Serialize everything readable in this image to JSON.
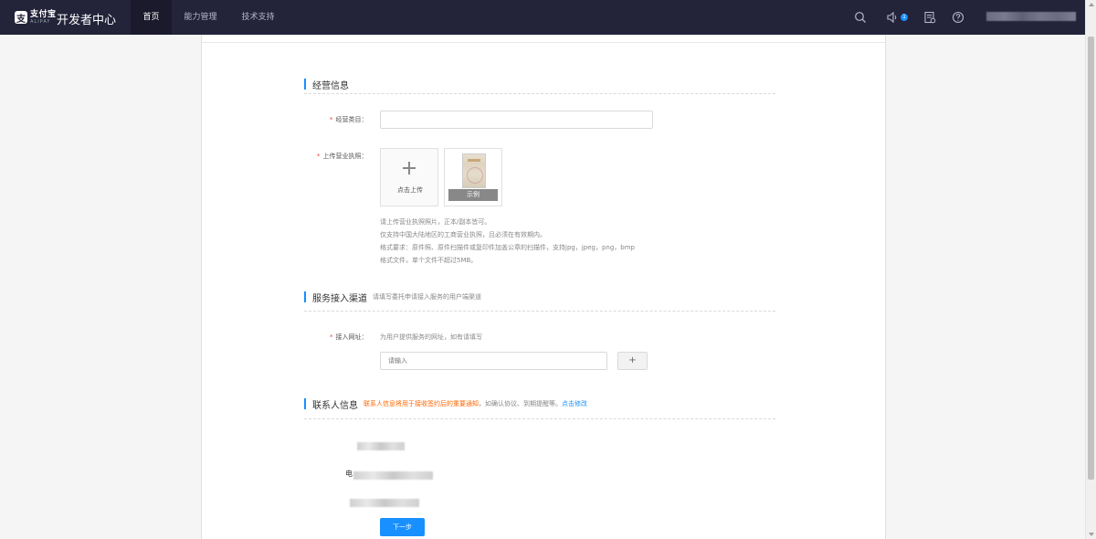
{
  "colors": {
    "topbar": "#23233a",
    "accent": "#1890ff",
    "required": "#f04134",
    "warning": "#ff6600"
  },
  "header": {
    "logo_cn": "支付宝",
    "logo_en": "ALIPAY",
    "title": "开发者中心",
    "nav": [
      {
        "label": "首页",
        "active": true
      },
      {
        "label": "能力管理",
        "active": false
      },
      {
        "label": "技术支持",
        "active": false
      }
    ],
    "notification_count": "1",
    "icons": [
      "search-icon",
      "speaker-icon",
      "document-icon",
      "help-icon"
    ]
  },
  "business": {
    "title": "经营信息",
    "category_label": "经营类目：",
    "license_label": "上传营业执照：",
    "upload_text": "点击上传",
    "example_text": "示例",
    "hints": [
      "请上传营业执照照片，正本/副本皆可。",
      "仅支持中国大陆地区的工商营业执照，且必须在有效期内。",
      "格式要求：原件照、原件扫描件或复印件加盖公章的扫描件，支持jpg，jpeg，png，bmp",
      "格式文件，单个文件不超过5MB。"
    ]
  },
  "channel": {
    "title": "服务接入渠道",
    "subtitle": "请填写委托申请接入服务的用户端渠道",
    "url_label": "接入网址：",
    "url_hint": "为用户提供服务的网址，如有请填写",
    "url_placeholder": "请输入",
    "add_label": "+"
  },
  "contact": {
    "title": "联系人信息",
    "notice_orange": "联系人信息将用于接收签约后的重要通知",
    "notice_gray": "，如确认协议、到期提醒等。",
    "notice_link": "点击修改",
    "phone_char": "电"
  },
  "actions": {
    "next": "下一步"
  }
}
